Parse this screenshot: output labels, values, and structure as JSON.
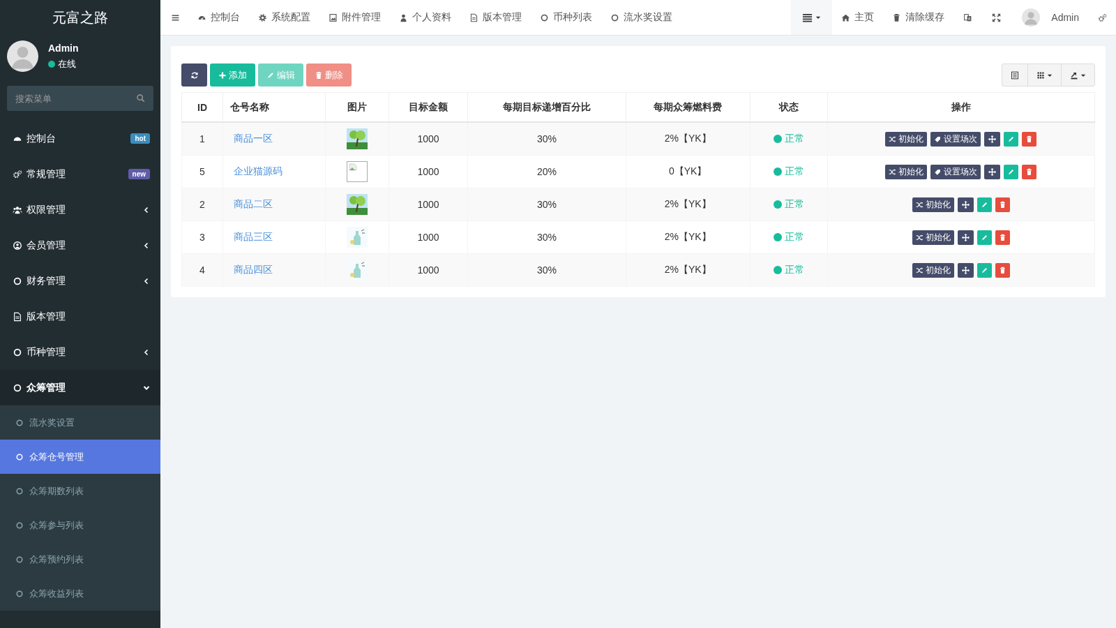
{
  "sidebar": {
    "brand": "元富之路",
    "user": {
      "name": "Admin",
      "status": "在线"
    },
    "search": {
      "placeholder": "搜索菜单"
    },
    "items": [
      {
        "label": "控制台",
        "kind": "dashboard",
        "badge": {
          "text": "hot",
          "color": "#3c8dbc"
        },
        "selected": false
      },
      {
        "label": "常规管理",
        "kind": "gears",
        "badge": {
          "text": "new",
          "color": "#605ca8"
        },
        "selected": false
      },
      {
        "label": "权限管理",
        "kind": "users",
        "has_children": true,
        "expanded": false,
        "selected": false
      },
      {
        "label": "会员管理",
        "kind": "user-circle",
        "has_children": true,
        "expanded": false,
        "selected": false
      },
      {
        "label": "财务管理",
        "kind": "circle",
        "has_children": true,
        "expanded": false,
        "selected": false
      },
      {
        "label": "版本管理",
        "kind": "file",
        "selected": false
      },
      {
        "label": "币种管理",
        "kind": "circle",
        "has_children": true,
        "expanded": false,
        "selected": false
      },
      {
        "label": "众筹管理",
        "kind": "circle",
        "has_children": true,
        "expanded": true,
        "selected": false,
        "children": [
          {
            "label": "流水奖设置",
            "selected": false
          },
          {
            "label": "众筹仓号管理",
            "selected": true
          },
          {
            "label": "众筹期数列表",
            "selected": false
          },
          {
            "label": "众筹参与列表",
            "selected": false
          },
          {
            "label": "众筹预约列表",
            "selected": false
          },
          {
            "label": "众筹收益列表",
            "selected": false
          }
        ]
      }
    ]
  },
  "topbar": {
    "tabs": [
      {
        "label": "控制台",
        "kind": "dashboard"
      },
      {
        "label": "系统配置",
        "kind": "gear"
      },
      {
        "label": "附件管理",
        "kind": "image"
      },
      {
        "label": "个人资料",
        "kind": "user"
      },
      {
        "label": "版本管理",
        "kind": "file"
      },
      {
        "label": "币种列表",
        "kind": "circle"
      },
      {
        "label": "流水奖设置",
        "kind": "circle"
      }
    ],
    "right": [
      {
        "kind": "menu"
      },
      {
        "kind": "home",
        "label": "主页"
      },
      {
        "kind": "trash",
        "label": "清除缓存"
      },
      {
        "kind": "translate"
      },
      {
        "kind": "fullscreen"
      },
      {
        "kind": "user",
        "label": "Admin"
      },
      {
        "kind": "settings"
      }
    ]
  },
  "toolbar": {
    "buttons": [
      {
        "kind": "refresh",
        "disabled": false
      },
      {
        "kind": "add",
        "label": "添加",
        "disabled": false
      },
      {
        "kind": "edit",
        "label": "编辑",
        "disabled": true
      },
      {
        "kind": "delete",
        "label": "删除",
        "disabled": true
      }
    ],
    "right": [
      {
        "kind": "list"
      },
      {
        "kind": "columns"
      },
      {
        "kind": "export"
      }
    ]
  },
  "table": {
    "columns": [
      "ID",
      "仓号名称",
      "图片",
      "目标金额",
      "每期目标递增百分比",
      "每期众筹燃料费",
      "状态",
      "操作"
    ],
    "rows": [
      {
        "id": "1",
        "name": "商品一区",
        "image": {
          "kind": "tree"
        },
        "target": "1000",
        "percent": "30%",
        "fee": "2%【YK】",
        "status": "正常",
        "actions": [
          {
            "kind": "init",
            "label": "初始化"
          },
          {
            "kind": "set",
            "label": "设置场次"
          },
          {
            "kind": "move"
          },
          {
            "kind": "edit"
          },
          {
            "kind": "delete"
          }
        ]
      },
      {
        "id": "5",
        "name": "企业猫源码",
        "image": {
          "kind": "broken"
        },
        "target": "1000",
        "percent": "20%",
        "fee": "0【YK】",
        "status": "正常",
        "actions": [
          {
            "kind": "init",
            "label": "初始化"
          },
          {
            "kind": "set",
            "label": "设置场次"
          },
          {
            "kind": "move"
          },
          {
            "kind": "edit"
          },
          {
            "kind": "delete"
          }
        ]
      },
      {
        "id": "2",
        "name": "商品二区",
        "image": {
          "kind": "tree"
        },
        "target": "1000",
        "percent": "30%",
        "fee": "2%【YK】",
        "status": "正常",
        "actions": [
          {
            "kind": "init",
            "label": "初始化"
          },
          {
            "kind": "move"
          },
          {
            "kind": "edit"
          },
          {
            "kind": "delete"
          }
        ]
      },
      {
        "id": "3",
        "name": "商品三区",
        "image": {
          "kind": "bottle"
        },
        "target": "1000",
        "percent": "30%",
        "fee": "2%【YK】",
        "status": "正常",
        "actions": [
          {
            "kind": "init",
            "label": "初始化"
          },
          {
            "kind": "move"
          },
          {
            "kind": "edit"
          },
          {
            "kind": "delete"
          }
        ]
      },
      {
        "id": "4",
        "name": "商品四区",
        "image": {
          "kind": "bottle"
        },
        "target": "1000",
        "percent": "30%",
        "fee": "2%【YK】",
        "status": "正常",
        "actions": [
          {
            "kind": "init",
            "label": "初始化"
          },
          {
            "kind": "move"
          },
          {
            "kind": "edit"
          },
          {
            "kind": "delete"
          }
        ]
      }
    ]
  }
}
